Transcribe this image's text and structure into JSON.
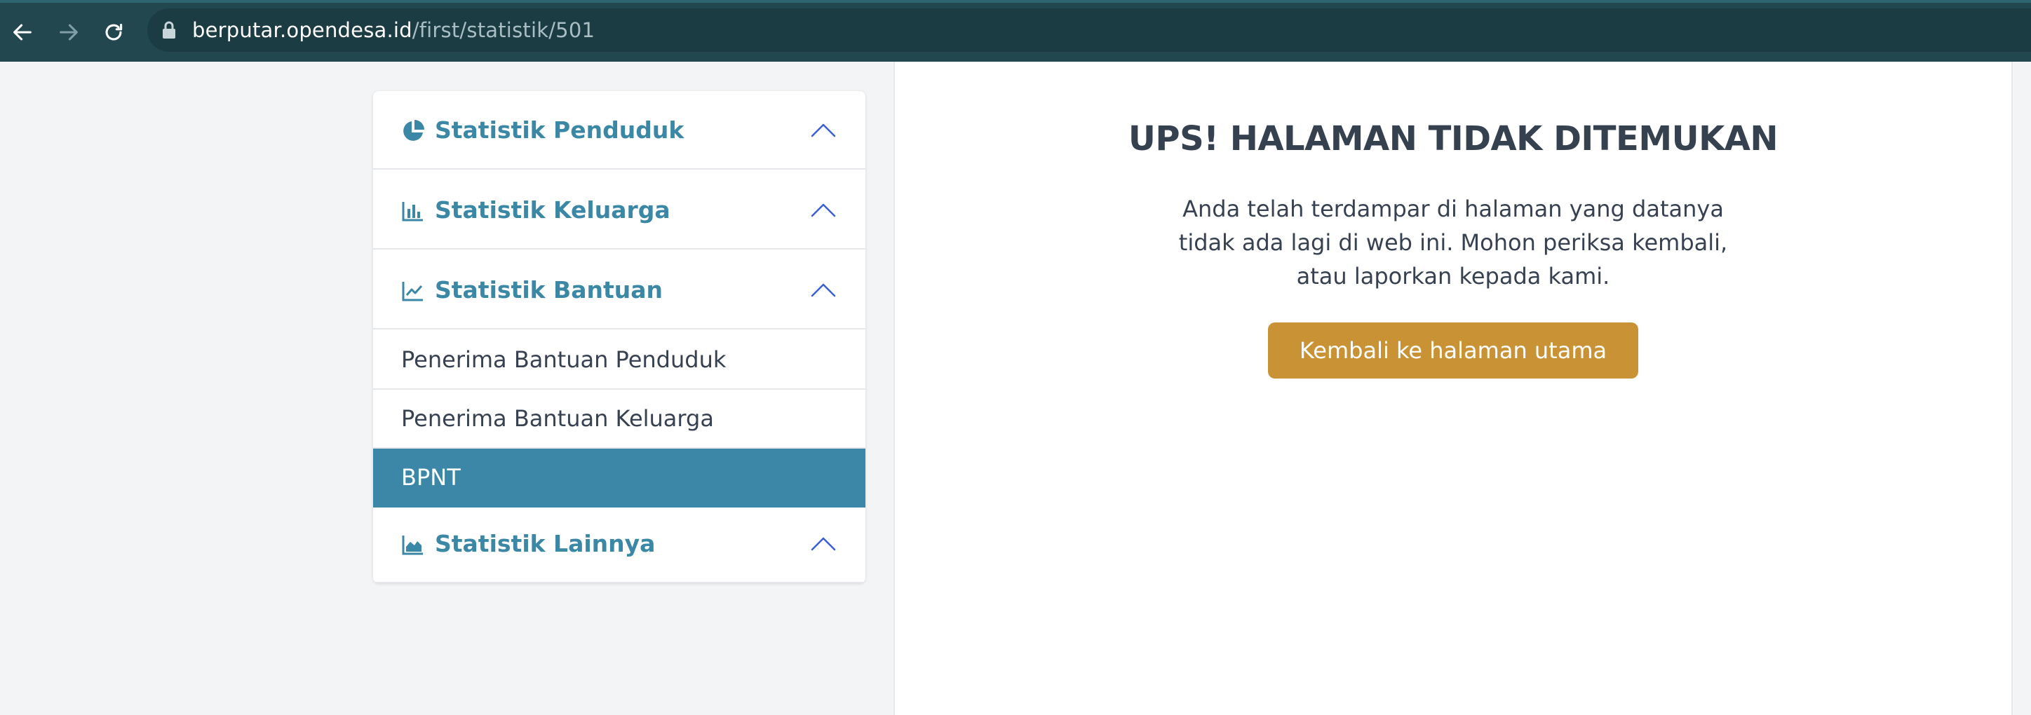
{
  "browser": {
    "url_host": "berputar.opendesa.id",
    "url_path": "/first/statistik/501"
  },
  "sidebar": {
    "sections": [
      {
        "title": "Statistik Penduduk",
        "icon": "pie-chart-icon",
        "expanded": true
      },
      {
        "title": "Statistik Keluarga",
        "icon": "bar-chart-icon",
        "expanded": true
      },
      {
        "title": "Statistik Bantuan",
        "icon": "line-chart-icon",
        "expanded": true,
        "items": [
          {
            "label": "Penerima Bantuan Penduduk",
            "active": false
          },
          {
            "label": "Penerima Bantuan Keluarga",
            "active": false
          },
          {
            "label": "BPNT",
            "active": true
          }
        ]
      },
      {
        "title": "Statistik Lainnya",
        "icon": "area-chart-icon",
        "expanded": true
      }
    ]
  },
  "error": {
    "title": "UPS! HALAMAN TIDAK DITEMUKAN",
    "message_lines": [
      "Anda telah terdampar di halaman yang datanya",
      "tidak ada lagi di web ini. Mohon periksa kembali,",
      "atau laporkan kepada kami."
    ],
    "button_label": "Kembali ke halaman utama"
  },
  "colors": {
    "browser_bar": "#22474f",
    "accent": "#3c87a7",
    "button": "#c99234",
    "title_text": "#36414f"
  }
}
